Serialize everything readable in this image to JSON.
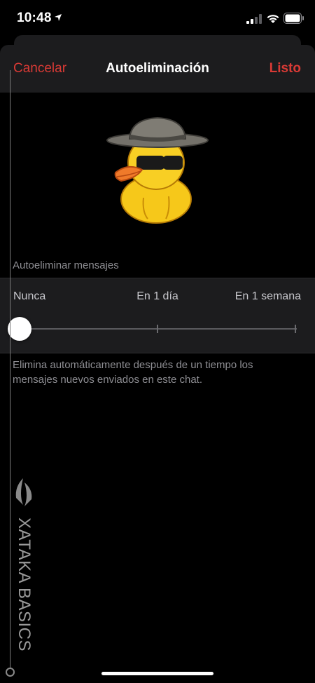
{
  "status_bar": {
    "time": "10:48",
    "icons": [
      "location-arrow-icon",
      "signal-icon",
      "wifi-icon",
      "battery-icon"
    ]
  },
  "navbar": {
    "cancel_label": "Cancelar",
    "title": "Autoeliminación",
    "done_label": "Listo"
  },
  "sticker": {
    "icon": "duck-with-hat-and-sunglasses-sticker"
  },
  "section": {
    "header": "Autoeliminar mensajes"
  },
  "slider": {
    "options": [
      "Nunca",
      "En 1 día",
      "En 1 semana"
    ],
    "selected": "Nunca",
    "selected_index": 0
  },
  "footer": {
    "note": "Elimina automáticamente después de un tiempo los mensajes nuevos enviados en este chat."
  },
  "watermark": {
    "text": "XATAKA BASICS"
  },
  "colors": {
    "accent": "#d93a35",
    "background": "#000000",
    "panel": "#1c1c1e",
    "secondary_text": "#8e8e93"
  }
}
